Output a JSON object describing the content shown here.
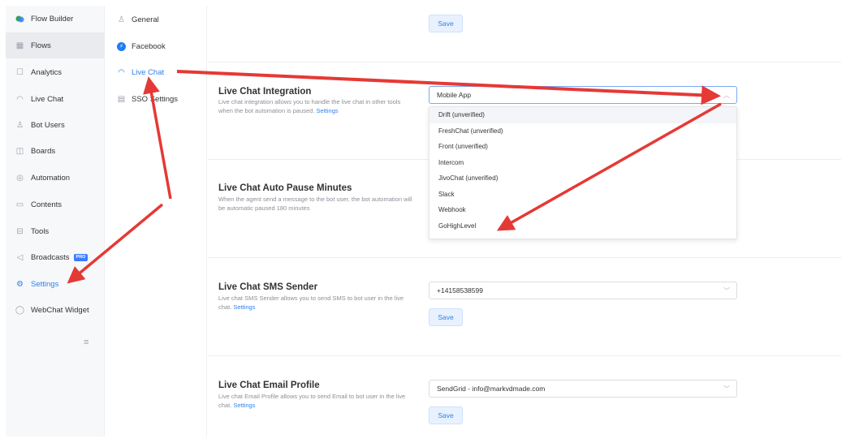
{
  "sidebar": {
    "items": [
      {
        "label": "Flow Builder",
        "icon": "flow-builder-icon"
      },
      {
        "label": "Flows",
        "icon": "grid-icon"
      },
      {
        "label": "Analytics",
        "icon": "chart-icon"
      },
      {
        "label": "Live Chat",
        "icon": "headset-icon"
      },
      {
        "label": "Bot Users",
        "icon": "user-icon"
      },
      {
        "label": "Boards",
        "icon": "board-icon"
      },
      {
        "label": "Automation",
        "icon": "automation-icon"
      },
      {
        "label": "Contents",
        "icon": "contents-icon"
      },
      {
        "label": "Tools",
        "icon": "tools-icon"
      },
      {
        "label": "Broadcasts",
        "icon": "megaphone-icon",
        "badge": "PRO"
      },
      {
        "label": "Settings",
        "icon": "gear-icon"
      },
      {
        "label": "WebChat Widget",
        "icon": "chat-bubble-icon"
      }
    ],
    "collapse_icon": "hamburger-icon"
  },
  "subnav": {
    "items": [
      {
        "label": "General",
        "icon": "user-icon"
      },
      {
        "label": "Facebook",
        "icon": "messenger-icon"
      },
      {
        "label": "Live Chat",
        "icon": "headset-icon"
      },
      {
        "label": "SSO Settings",
        "icon": "id-card-icon"
      }
    ]
  },
  "top": {
    "save_label": "Save"
  },
  "integration": {
    "title": "Live Chat Integration",
    "desc": "Live chat integration allows you to handle the live chat in other tools when the bot automation is paused.",
    "link": "Settings",
    "selected": "Mobile App",
    "options": [
      "Drift (unverified)",
      "FreshChat (unverified)",
      "Front (unverified)",
      "Intercom",
      "JivoChat (unverified)",
      "Slack",
      "Webhook",
      "GoHighLevel"
    ]
  },
  "pause": {
    "title": "Live Chat Auto Pause Minutes",
    "desc": "When the agent send a message to the bot user, the bot automation will be automatic paused 180 minutes"
  },
  "sms": {
    "title": "Live Chat SMS Sender",
    "desc": "Live chat SMS Sender allows you to send SMS to bot user in the live chat.",
    "link": "Settings",
    "selected": "+14158538599",
    "save_label": "Save"
  },
  "email": {
    "title": "Live Chat Email Profile",
    "desc": "Live chat Email Profile allows you to send Email to bot user in the live chat.",
    "link": "Settings",
    "selected": "SendGrid - info@markvdmade.com",
    "save_label": "Save"
  },
  "colors": {
    "accent": "#2f80ed",
    "arrow": "#e53935"
  }
}
